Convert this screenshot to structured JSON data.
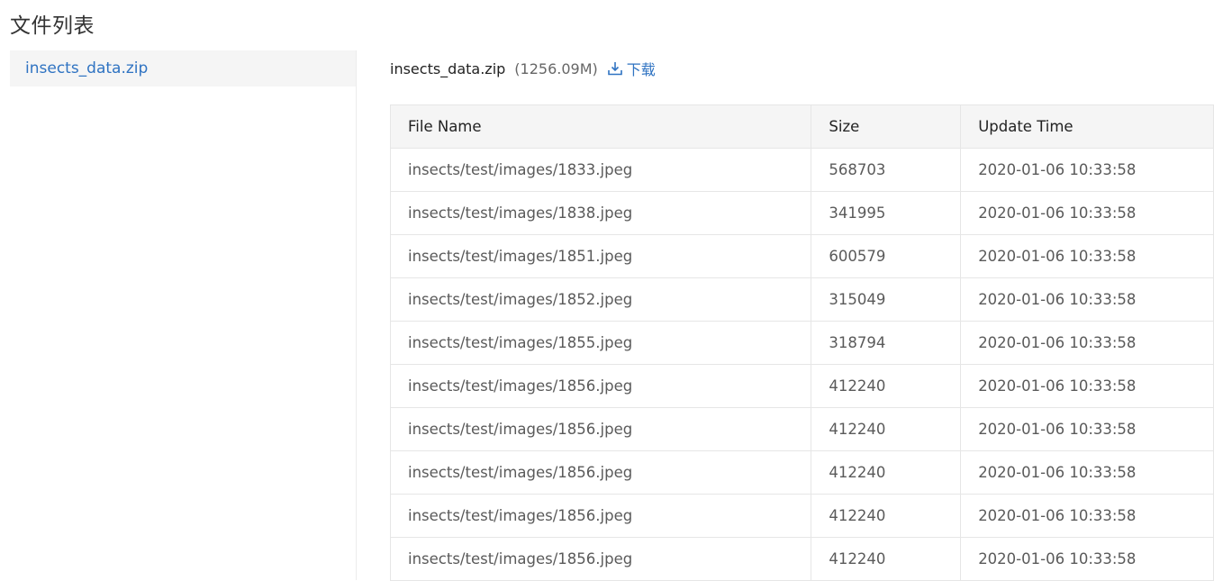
{
  "page": {
    "title": "文件列表"
  },
  "sidebar": {
    "items": [
      {
        "label": "insects_data.zip"
      }
    ]
  },
  "file": {
    "name": "insects_data.zip",
    "size": "(1256.09M)",
    "download_label": "下载",
    "download_icon": "download-icon"
  },
  "colors": {
    "accent": "#2f73c2",
    "header_bg": "#f5f5f5",
    "border": "#e6e6e6"
  },
  "table": {
    "columns": [
      "File Name",
      "Size",
      "Update Time"
    ],
    "rows": [
      [
        "insects/test/images/1833.jpeg",
        "568703",
        "2020-01-06 10:33:58"
      ],
      [
        "insects/test/images/1838.jpeg",
        "341995",
        "2020-01-06 10:33:58"
      ],
      [
        "insects/test/images/1851.jpeg",
        "600579",
        "2020-01-06 10:33:58"
      ],
      [
        "insects/test/images/1852.jpeg",
        "315049",
        "2020-01-06 10:33:58"
      ],
      [
        "insects/test/images/1855.jpeg",
        "318794",
        "2020-01-06 10:33:58"
      ],
      [
        "insects/test/images/1856.jpeg",
        "412240",
        "2020-01-06 10:33:58"
      ],
      [
        "insects/test/images/1856.jpeg",
        "412240",
        "2020-01-06 10:33:58"
      ],
      [
        "insects/test/images/1856.jpeg",
        "412240",
        "2020-01-06 10:33:58"
      ],
      [
        "insects/test/images/1856.jpeg",
        "412240",
        "2020-01-06 10:33:58"
      ],
      [
        "insects/test/images/1856.jpeg",
        "412240",
        "2020-01-06 10:33:58"
      ]
    ]
  }
}
